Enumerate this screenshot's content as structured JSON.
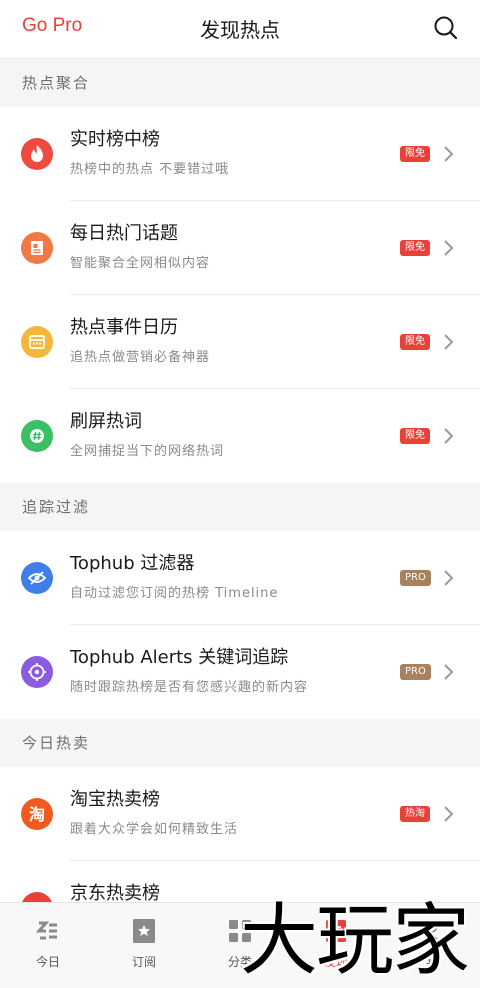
{
  "header": {
    "gopro_label": "Go Pro",
    "title": "发现热点",
    "search_icon": "search-icon"
  },
  "sections": [
    {
      "title": "热点聚合",
      "items": [
        {
          "name": "实时榜中榜",
          "desc": "热榜中的热点 不要错过哦",
          "badge": "限免",
          "badge_color": "#e8413a",
          "icon": "flame-icon",
          "icon_color": "#ef4a3f"
        },
        {
          "name": "每日热门话题",
          "desc": "智能聚合全网相似内容",
          "badge": "限免",
          "badge_color": "#e8413a",
          "icon": "document-icon",
          "icon_color": "#f07a45"
        },
        {
          "name": "热点事件日历",
          "desc": "追热点做营销必备神器",
          "badge": "限免",
          "badge_color": "#e8413a",
          "icon": "calendar-icon",
          "icon_color": "#f4b73a"
        },
        {
          "name": "刷屏热词",
          "desc": "全网捕捉当下的网络热词",
          "badge": "限免",
          "badge_color": "#e8413a",
          "icon": "hashtag-icon",
          "icon_color": "#3bbf63"
        }
      ]
    },
    {
      "title": "追踪过滤",
      "items": [
        {
          "name": "Tophub 过滤器",
          "desc": "自动过滤您订阅的热榜 Timeline",
          "badge": "PRO",
          "badge_color": "#a8825c",
          "icon": "eye-off-icon",
          "icon_color": "#3f7fe8"
        },
        {
          "name": "Tophub Alerts 关键词追踪",
          "desc": "随时跟踪热榜是否有您感兴趣的新内容",
          "badge": "PRO",
          "badge_color": "#a8825c",
          "icon": "target-icon",
          "icon_color": "#8a5ce0"
        }
      ]
    },
    {
      "title": "今日热卖",
      "items": [
        {
          "name": "淘宝热卖榜",
          "desc": "跟着大众学会如何精致生活",
          "badge": "热淘",
          "badge_color": "#e8413a",
          "icon": "taobao-icon",
          "icon_color": "#f05a1e"
        },
        {
          "name": "京东热卖榜",
          "desc": "",
          "badge": "",
          "badge_color": "#e8413a",
          "icon": "jd-icon",
          "icon_color": "#e8413a"
        }
      ]
    }
  ],
  "tabbar": {
    "tabs": [
      {
        "label": "今日",
        "icon": "today-icon",
        "active": false
      },
      {
        "label": "订阅",
        "icon": "bookmark-star-icon",
        "active": false
      },
      {
        "label": "分类",
        "icon": "grid-icon",
        "active": false
      },
      {
        "label": "发现",
        "icon": "discover-icon",
        "active": true
      },
      {
        "label": "我",
        "icon": "user-icon",
        "active": false
      }
    ]
  },
  "watermark": "大玩家",
  "colors": {
    "accent": "#e8413a",
    "pro": "#a8825c",
    "section_bg": "#f4f5f6"
  }
}
